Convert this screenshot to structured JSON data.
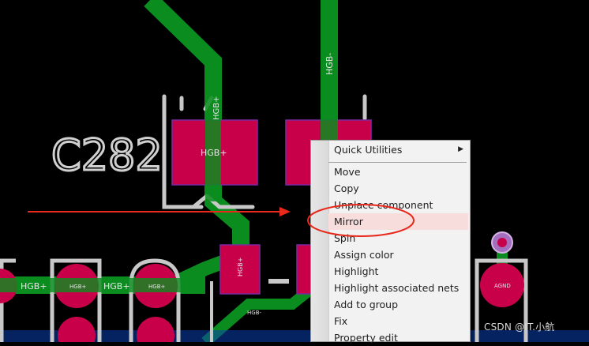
{
  "board": {
    "designator": "C282",
    "pad_net_labels": {
      "left_pad": "HGB+",
      "trace_vertical_right": "HGB-",
      "trace_vertical_top": "HGB+",
      "small_pad_left": "HGB+",
      "small_pad_trace": "HGB-",
      "bottom_trace_1": "HGB+",
      "bottom_pad_1": "HGB+",
      "bottom_trace_2": "HGB+",
      "bottom_pad_2": "HGB+",
      "right_pad": "AGND"
    }
  },
  "context_menu": {
    "items": [
      {
        "label": "Quick Utilities",
        "has_submenu": true
      },
      {
        "label": "Move"
      },
      {
        "label": "Copy"
      },
      {
        "label": "Unplace component"
      },
      {
        "label": "Mirror",
        "highlighted": true
      },
      {
        "label": "Spin"
      },
      {
        "label": "Assign color"
      },
      {
        "label": "Highlight"
      },
      {
        "label": "Highlight associated nets"
      },
      {
        "label": "Add to group"
      },
      {
        "label": "Fix"
      },
      {
        "label": "Property edit"
      }
    ]
  },
  "watermark": "CSDN @IT.小航",
  "colors": {
    "background": "#000000",
    "pad": "#c8004a",
    "trace": "#0a8c1e",
    "silkscreen": "#c8c8c8",
    "annotation_red": "#e8291c",
    "menu_highlight": "#f7dedd"
  }
}
